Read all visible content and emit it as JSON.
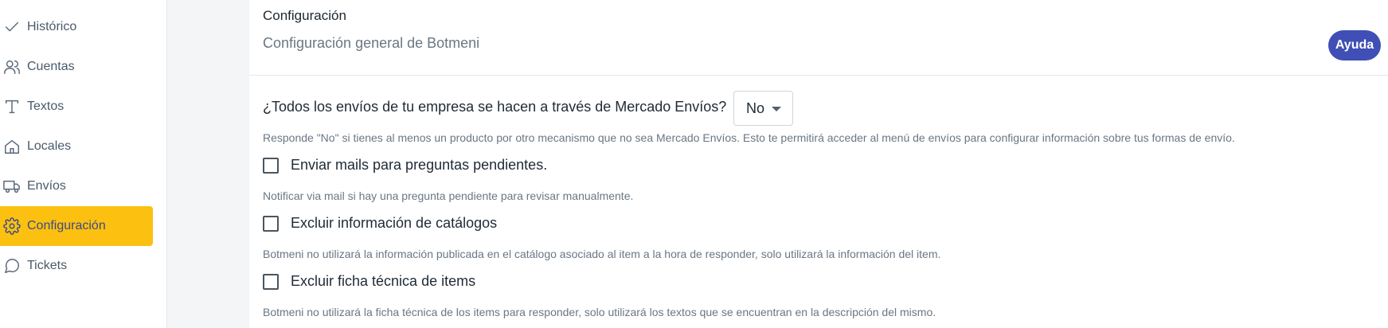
{
  "sidebar": {
    "items": [
      {
        "label": "Histórico",
        "icon": "check-icon"
      },
      {
        "label": "Cuentas",
        "icon": "users-icon"
      },
      {
        "label": "Textos",
        "icon": "text-icon"
      },
      {
        "label": "Locales",
        "icon": "home-icon"
      },
      {
        "label": "Envíos",
        "icon": "truck-icon"
      },
      {
        "label": "Configuración",
        "icon": "gear-icon",
        "active": true
      },
      {
        "label": "Tickets",
        "icon": "chat-icon"
      }
    ]
  },
  "header": {
    "title": "Configuración",
    "subtitle": "Configuración general de Botmeni",
    "help_label": "Ayuda"
  },
  "settings": {
    "shipping_question": "¿Todos los envíos de tu empresa se hacen a través de Mercado Envíos?",
    "shipping_value": "No",
    "shipping_hint": "Responde \"No\" si tienes al menos un producto por otro mecanismo que no sea Mercado Envíos. Esto te permitirá acceder al menú de envíos para configurar información sobre tus formas de envío.",
    "options": [
      {
        "label": "Enviar mails para preguntas pendientes.",
        "hint": "Notificar via mail si hay una pregunta pendiente para revisar manualmente.",
        "checked": false
      },
      {
        "label": "Excluir información de catálogos",
        "hint": "Botmeni no utilizará la información publicada en el catálogo asociado al item a la hora de responder, solo utilizará la información del item.",
        "checked": false
      },
      {
        "label": "Excluir ficha técnica de items",
        "hint": "Botmeni no utilizará la ficha técnica de los items para responder, solo utilizará los textos que se encuentran en la descripción del mismo.",
        "checked": false
      }
    ]
  },
  "colors": {
    "accent": "#fcc010",
    "primary": "#3f4fb5",
    "active_text": "#3b4a8c"
  }
}
